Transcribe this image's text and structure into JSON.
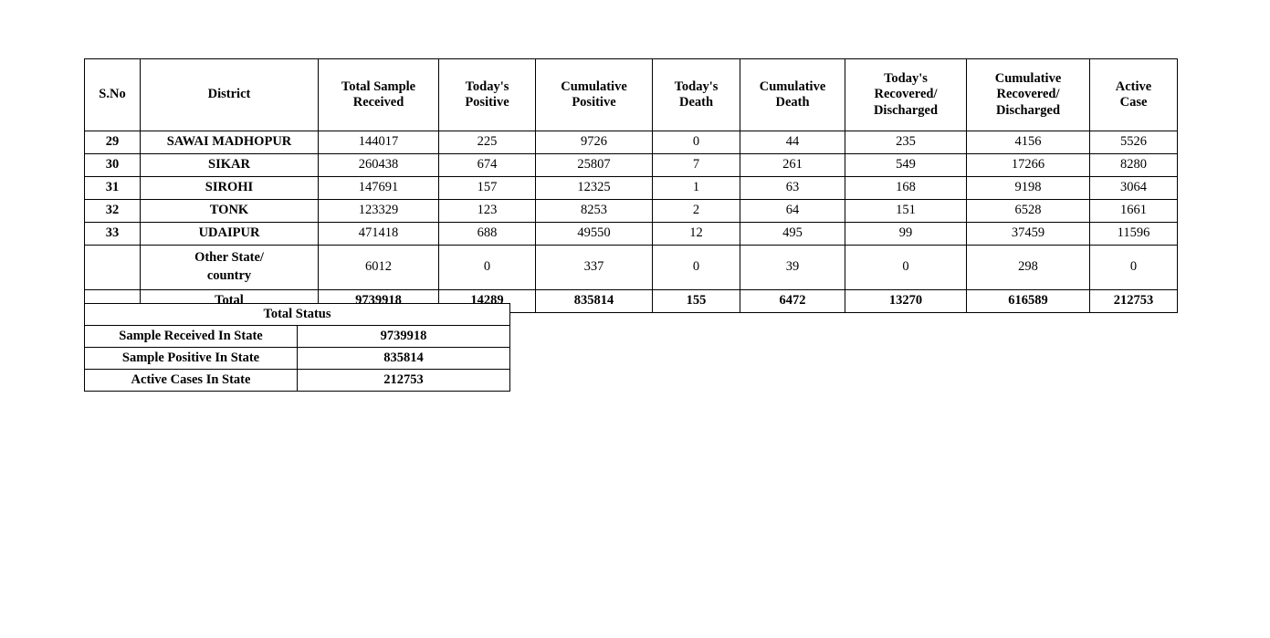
{
  "district_table": {
    "headers": [
      "S.No",
      "District",
      "Total Sample Received",
      "Today's Positive",
      "Cumulative Positive",
      "Today's Death",
      "Cumulative Death",
      "Today's Recovered/ Discharged",
      "Cumulative Recovered/ Discharged",
      "Active Case"
    ],
    "header_lines": [
      [
        "S.No"
      ],
      [
        "District"
      ],
      [
        "Total Sample",
        "Received"
      ],
      [
        "Today's",
        "Positive"
      ],
      [
        "Cumulative",
        "Positive"
      ],
      [
        "Today's",
        "Death"
      ],
      [
        "Cumulative",
        "Death"
      ],
      [
        "Today's",
        "Recovered/",
        "Discharged"
      ],
      [
        "Cumulative",
        "Recovered/",
        "Discharged"
      ],
      [
        "Active",
        "Case"
      ]
    ],
    "rows": [
      {
        "sno": "29",
        "district": "SAWAI MADHOPUR",
        "total_sample_received": "144017",
        "todays_positive": "225",
        "cumulative_positive": "9726",
        "todays_death": "0",
        "cumulative_death": "44",
        "todays_recovered": "235",
        "cumulative_recovered": "4156",
        "active_case": "5526"
      },
      {
        "sno": "30",
        "district": "SIKAR",
        "total_sample_received": "260438",
        "todays_positive": "674",
        "cumulative_positive": "25807",
        "todays_death": "7",
        "cumulative_death": "261",
        "todays_recovered": "549",
        "cumulative_recovered": "17266",
        "active_case": "8280"
      },
      {
        "sno": "31",
        "district": "SIROHI",
        "total_sample_received": "147691",
        "todays_positive": "157",
        "cumulative_positive": "12325",
        "todays_death": "1",
        "cumulative_death": "63",
        "todays_recovered": "168",
        "cumulative_recovered": "9198",
        "active_case": "3064"
      },
      {
        "sno": "32",
        "district": "TONK",
        "total_sample_received": "123329",
        "todays_positive": "123",
        "cumulative_positive": "8253",
        "todays_death": "2",
        "cumulative_death": "64",
        "todays_recovered": "151",
        "cumulative_recovered": "6528",
        "active_case": "1661"
      },
      {
        "sno": "33",
        "district": "UDAIPUR",
        "total_sample_received": "471418",
        "todays_positive": "688",
        "cumulative_positive": "49550",
        "todays_death": "12",
        "cumulative_death": "495",
        "todays_recovered": "99",
        "cumulative_recovered": "37459",
        "active_case": "11596"
      },
      {
        "sno": "",
        "district": "Other State/ country",
        "district_line1": "Other State/",
        "district_line2": "country",
        "total_sample_received": "6012",
        "todays_positive": "0",
        "cumulative_positive": "337",
        "todays_death": "0",
        "cumulative_death": "39",
        "todays_recovered": "0",
        "cumulative_recovered": "298",
        "active_case": "0"
      },
      {
        "sno": "",
        "district": "Total",
        "total_sample_received": "9739918",
        "todays_positive": "14289",
        "cumulative_positive": "835814",
        "todays_death": "155",
        "cumulative_death": "6472",
        "todays_recovered": "13270",
        "cumulative_recovered": "616589",
        "active_case": "212753"
      }
    ]
  },
  "status_table": {
    "title": "Total Status",
    "rows": [
      {
        "label": "Sample Received In State",
        "value": "9739918"
      },
      {
        "label": "Sample Positive In State",
        "value": "835814"
      },
      {
        "label": "Active Cases In State",
        "value": "212753"
      }
    ]
  },
  "colors": {
    "border": "#000000",
    "text": "#000000",
    "background": "#ffffff",
    "gutter": "#444749"
  }
}
